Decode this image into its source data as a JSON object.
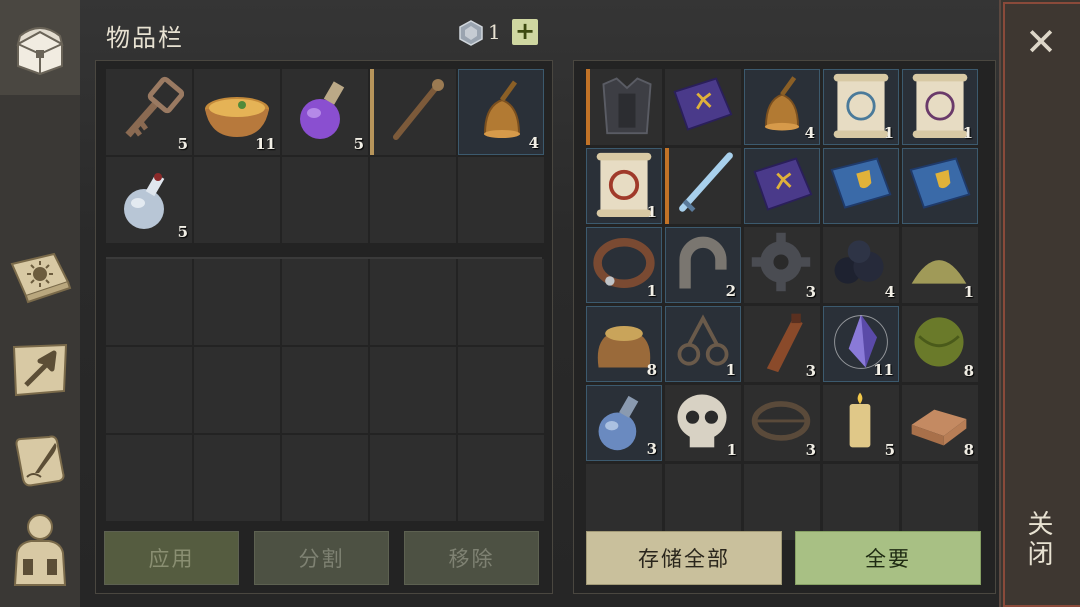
{
  "header": {
    "title": "物品栏",
    "currency_count": "1",
    "add_label": "+"
  },
  "left_slots": [
    {
      "icon": "key-icon",
      "count": "5"
    },
    {
      "icon": "soup-bowl-icon",
      "count": "11"
    },
    {
      "icon": "purple-potion-icon",
      "count": "5"
    },
    {
      "icon": "staff-icon",
      "count": ""
    },
    {
      "icon": "bell-icon",
      "count": "4"
    },
    {
      "icon": "white-potion-icon",
      "count": "5"
    }
  ],
  "right_slots": [
    {
      "icon": "armor-icon",
      "count": ""
    },
    {
      "icon": "purple-book-icon",
      "count": ""
    },
    {
      "icon": "bell-icon",
      "count": "4"
    },
    {
      "icon": "blue-scroll-icon",
      "count": "1"
    },
    {
      "icon": "purple-scroll-icon",
      "count": "1"
    },
    {
      "icon": "red-scroll-icon",
      "count": "1"
    },
    {
      "icon": "ice-sword-icon",
      "count": ""
    },
    {
      "icon": "purple-book-icon",
      "count": ""
    },
    {
      "icon": "blue-book-icon",
      "count": ""
    },
    {
      "icon": "blue-book-icon",
      "count": ""
    },
    {
      "icon": "collar-icon",
      "count": "1"
    },
    {
      "icon": "horseshoe-magnet-icon",
      "count": "2"
    },
    {
      "icon": "gear-icon",
      "count": "3"
    },
    {
      "icon": "coal-icon",
      "count": "4"
    },
    {
      "icon": "sand-pile-icon",
      "count": "1"
    },
    {
      "icon": "grain-sack-icon",
      "count": "8"
    },
    {
      "icon": "shackles-icon",
      "count": "1"
    },
    {
      "icon": "leather-bottle-icon",
      "count": "3"
    },
    {
      "icon": "crystal-icon",
      "count": "11"
    },
    {
      "icon": "moss-ball-icon",
      "count": "8"
    },
    {
      "icon": "blue-potion-icon",
      "count": "3"
    },
    {
      "icon": "skull-icon",
      "count": "1"
    },
    {
      "icon": "bear-trap-icon",
      "count": "3"
    },
    {
      "icon": "candle-icon",
      "count": "5"
    },
    {
      "icon": "cloth-icon",
      "count": "8"
    }
  ],
  "buttons": {
    "apply": "应用",
    "split": "分割",
    "remove": "移除",
    "store_all": "存储全部",
    "take_all": "全要"
  },
  "close": {
    "label": "关闭"
  },
  "nav": [
    "chest-icon",
    "sun-book-icon",
    "craft-arrow-icon",
    "quill-scroll-icon",
    "character-icon"
  ],
  "colors": {
    "accent_orange": "#c27327",
    "take_all_green": "#a8c084",
    "store_tan": "#c9c09c"
  }
}
